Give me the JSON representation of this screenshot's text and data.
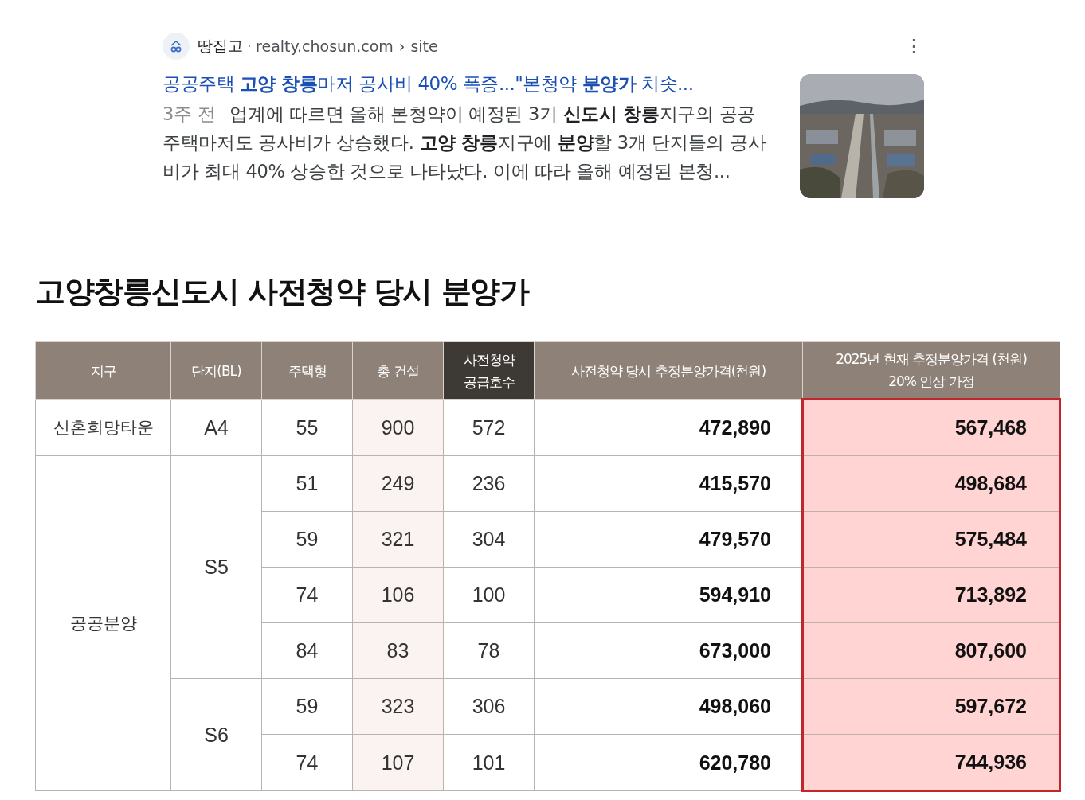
{
  "result": {
    "source": "땅집고",
    "dot": "·",
    "url": "realty.chosun.com",
    "separator": "›",
    "path": "site",
    "menu": "⋮",
    "title": "공공주택 **고양 창릉**마저 공사비 40% 폭증...\"본청약 **분양가** 치솟...",
    "age": "3주 전",
    "snippet": "업계에 따르면 올해 본청약이 예정된 3기 **신도시 창릉**지구의 공공 주택마저도 공사비가 상승했다. **고양 창릉**지구에 **분양**할 3개 단지들의 공사비가 최대 40% 상승한 것으로 나타났다. 이에 따라 올해 예정된 본청..."
  },
  "heading": "고양창릉신도시 사전청약 당시 분양가",
  "table": {
    "columns": [
      {
        "label": "지구",
        "dark": false
      },
      {
        "label": "단지(BL)",
        "dark": false
      },
      {
        "label": "주택형",
        "dark": false
      },
      {
        "label": "총 건설",
        "dark": false,
        "tinted": true
      },
      {
        "label": "사전청약\n공급호수",
        "dark": true
      },
      {
        "label": "사전청약 당시 추정분양가격(천원)",
        "dark": false
      },
      {
        "label": "2025년 현재 추정분양가격 (천원)\n20% 인상 가정",
        "dark": false,
        "highlighted": true
      }
    ],
    "groups": [
      {
        "district": "신혼희망타운",
        "complexes": [
          {
            "complex": "A4",
            "rows": [
              [
                "55",
                "900",
                "572",
                "472,890",
                "567,468"
              ]
            ]
          }
        ]
      },
      {
        "district": "공공분양",
        "complexes": [
          {
            "complex": "S5",
            "rows": [
              [
                "51",
                "249",
                "236",
                "415,570",
                "498,684"
              ],
              [
                "59",
                "321",
                "304",
                "479,570",
                "575,484"
              ],
              [
                "74",
                "106",
                "100",
                "594,910",
                "713,892"
              ],
              [
                "84",
                "83",
                "78",
                "673,000",
                "807,600"
              ]
            ]
          },
          {
            "complex": "S6",
            "rows": [
              [
                "59",
                "323",
                "306",
                "498,060",
                "597,672"
              ],
              [
                "74",
                "107",
                "101",
                "620,780",
                "744,936"
              ]
            ]
          }
        ]
      }
    ]
  }
}
